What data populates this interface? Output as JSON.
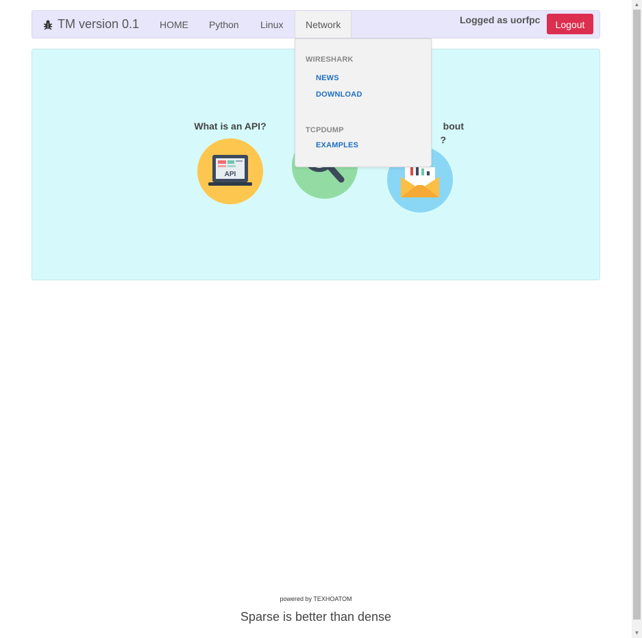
{
  "navbar": {
    "brand": "TM version 0.1",
    "items": [
      {
        "label": "HOME"
      },
      {
        "label": "Python"
      },
      {
        "label": "Linux"
      },
      {
        "label": "Network"
      }
    ],
    "logged_as": "Logged as uorfpc",
    "logout_label": "Logout"
  },
  "dropdown": {
    "groups": [
      {
        "header": "WIRESHARK",
        "links": [
          "NEWS",
          "DOWNLOAD"
        ]
      },
      {
        "header": "TCPDUMP",
        "links": [
          "EXAMPLES"
        ]
      }
    ]
  },
  "cards": [
    {
      "title": "What is an API?",
      "icon": "api-laptop-icon",
      "color": "#fdc74f"
    },
    {
      "title": "",
      "icon": "www-search-icon",
      "color": "#92dca3"
    },
    {
      "title_line1": "bout",
      "title_line2": "?",
      "icon": "mail-chart-icon",
      "color": "#8ad6f5"
    }
  ],
  "footer": {
    "powered": "powered by TEXHOATOM",
    "motto": "Sparse is better than dense"
  },
  "colors": {
    "navbar_bg": "#e8e6fb",
    "jumbotron_bg": "#d6fafb",
    "logout_bg": "#dc2f4f",
    "link": "#1f6fbf"
  }
}
